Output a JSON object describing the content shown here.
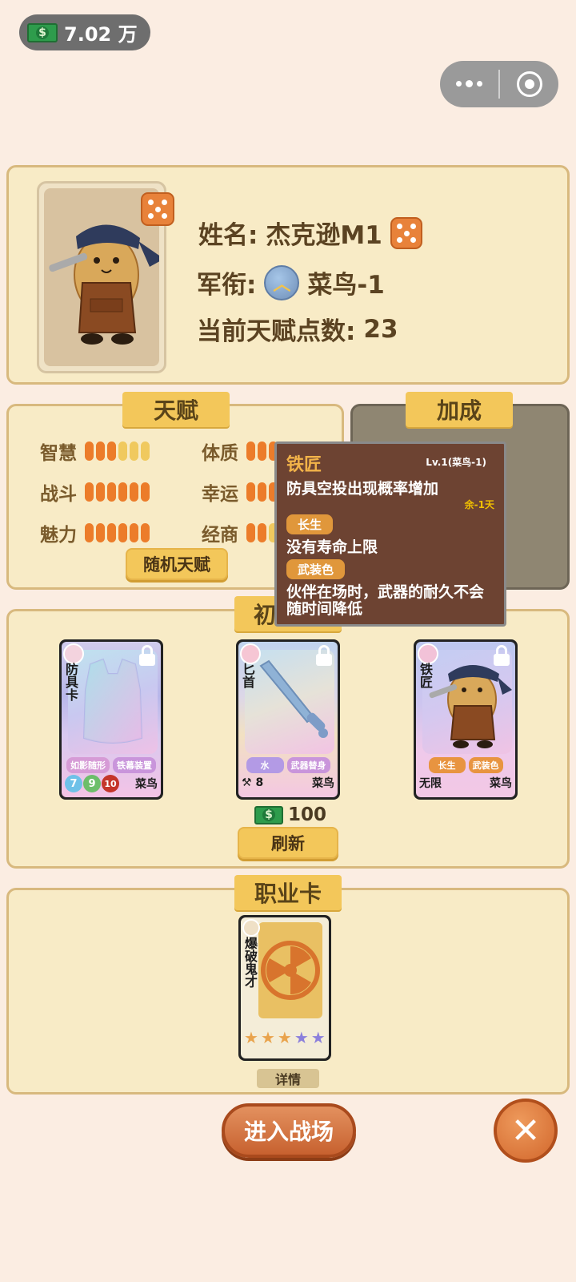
{
  "top": {
    "money": "7.02 万"
  },
  "profile": {
    "name_label": "姓名:",
    "name": "杰克逊M1",
    "rank_label": "军衔:",
    "rank": "菜鸟-1",
    "talent_points_label": "当前天赋点数:",
    "talent_points": "23"
  },
  "talent": {
    "title": "天赋",
    "stats": [
      {
        "label": "智慧",
        "filled": 3,
        "max": 6
      },
      {
        "label": "体质",
        "filled": 4,
        "max": 6
      },
      {
        "label": "战斗",
        "filled": 6,
        "max": 6
      },
      {
        "label": "幸运",
        "filled": 3,
        "max": 6
      },
      {
        "label": "魅力",
        "filled": 6,
        "max": 6
      },
      {
        "label": "经商",
        "filled": 2,
        "max": 6
      }
    ],
    "random_button": "随机天赋"
  },
  "bonus": {
    "title": "加成"
  },
  "tooltip": {
    "title": "铁匠",
    "level": "Lv.1(菜鸟-1)",
    "desc": "防具空投出现概率增加",
    "remaining": "余-1天",
    "trait1": "长生",
    "trait1_desc": "没有寿命上限",
    "trait2": "武装色",
    "trait2_desc": "伙伴在场时，武器的耐久不会随时间降低"
  },
  "initial": {
    "title": "初",
    "cards": [
      {
        "name": "防具卡",
        "tag1": "如影随形",
        "tag2": "铁幕装置",
        "nums": [
          "7",
          "9",
          "10"
        ],
        "rank": "菜鸟"
      },
      {
        "name": "匕首",
        "tag1": "水",
        "tag2": "武器替身",
        "count": "8",
        "rank": "菜鸟"
      },
      {
        "name": "铁匠",
        "tag1": "长生",
        "tag2": "武装色",
        "life": "无限",
        "rank": "菜鸟"
      }
    ],
    "price": "100",
    "refresh_button": "刷新"
  },
  "job": {
    "title": "职业卡",
    "card_name": "爆破鬼才",
    "stars": 5,
    "detail_button": "详情"
  },
  "actions": {
    "enter_button": "进入战场"
  },
  "colors": {
    "background": "#fbede2",
    "panel": "#f8ebc6",
    "accent": "#f3c75a",
    "orange": "#ec7c2a"
  }
}
